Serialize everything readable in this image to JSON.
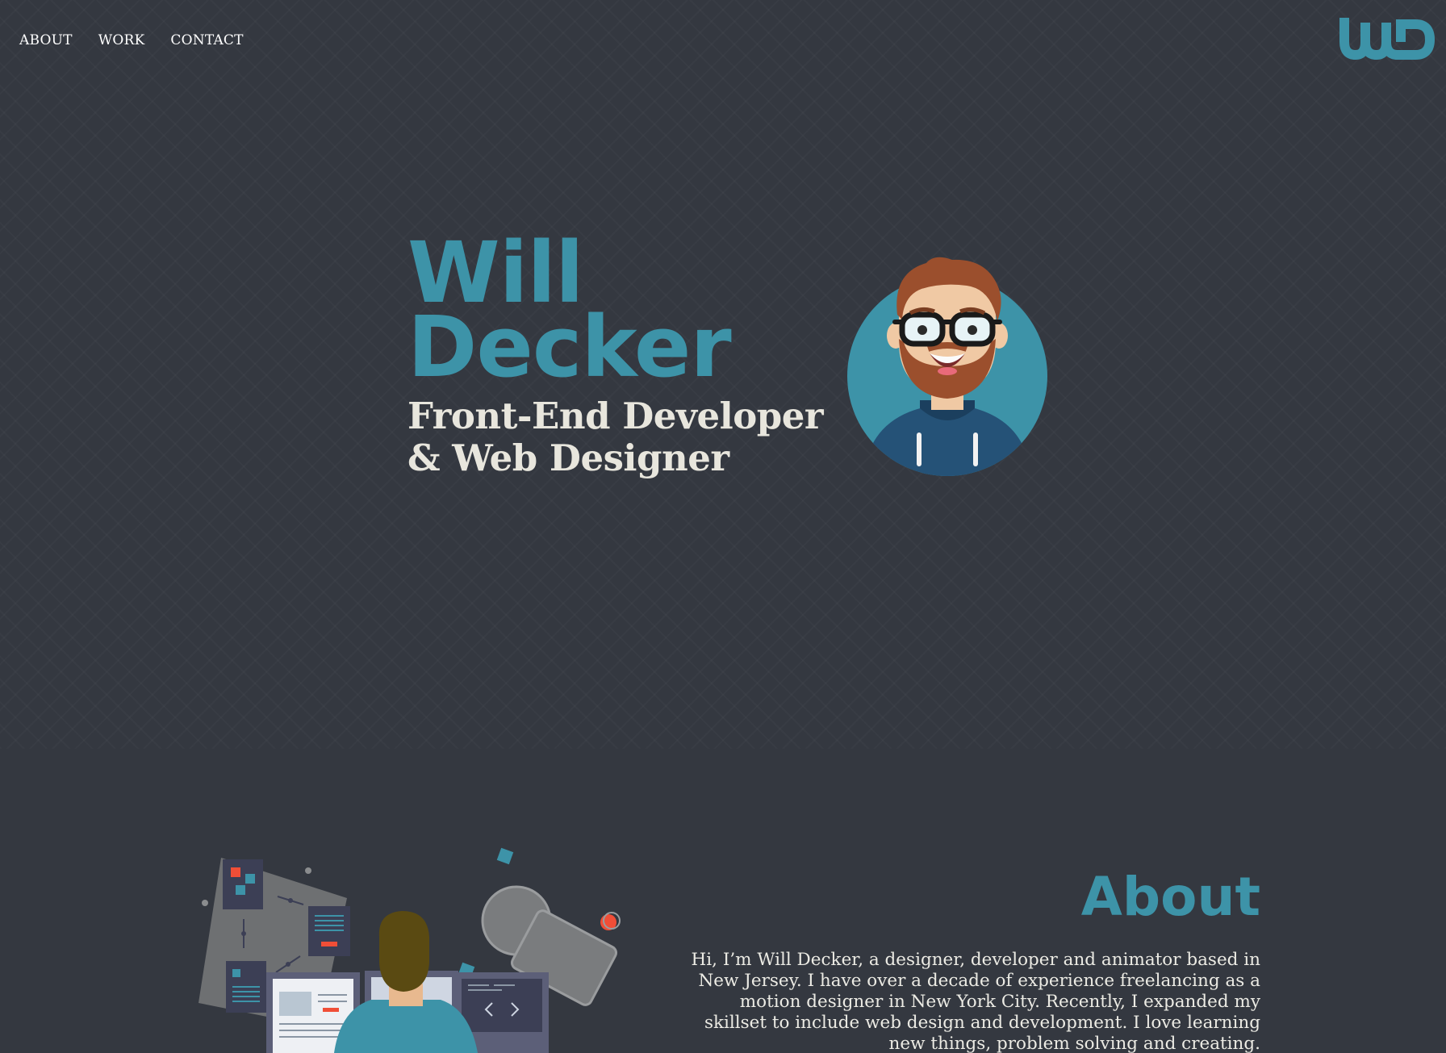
{
  "nav": {
    "items": [
      {
        "label": "ABOUT"
      },
      {
        "label": "WORK"
      },
      {
        "label": "CONTACT"
      }
    ]
  },
  "hero": {
    "first_name": "Will",
    "last_name": "Decker",
    "role_line1": "Front-End Developer",
    "role_line2": "& Web Designer"
  },
  "about": {
    "heading": "About",
    "body": "Hi, I’m Will Decker, a designer, developer and animator based in New Jersey. I have over a decade of experience freelancing as a motion designer in New York City. Recently, I expanded my skillset to include web design and development. I love learning new things, problem solving and creating."
  },
  "colors": {
    "background": "#343840",
    "accent": "#3d93a8",
    "text": "#e8e6dd"
  },
  "icons": {
    "logo": "wd-monogram-logo",
    "avatar": "cartoon-avatar-bearded-man-glasses",
    "illustration": "developer-at-desk-illustration"
  }
}
